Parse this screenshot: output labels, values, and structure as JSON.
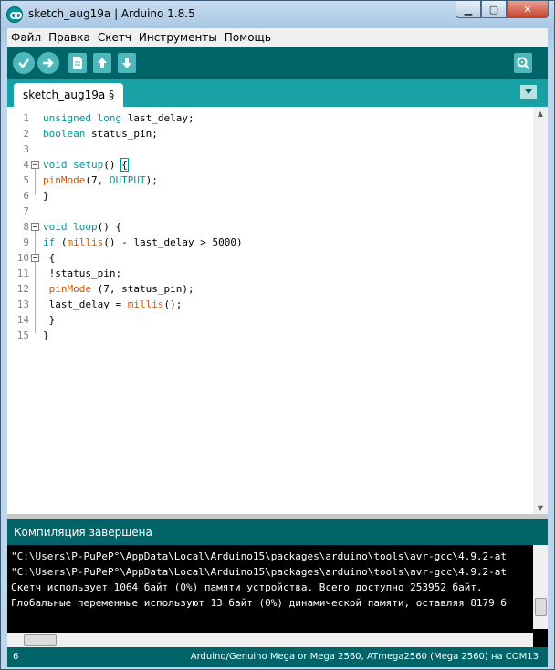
{
  "window": {
    "title": "sketch_aug19a | Arduino 1.8.5"
  },
  "menu": [
    "Файл",
    "Правка",
    "Скетч",
    "Инструменты",
    "Помощь"
  ],
  "toolbar": {
    "buttons": [
      {
        "name": "verify-icon"
      },
      {
        "name": "upload-icon"
      },
      {
        "name": "new-icon"
      },
      {
        "name": "open-icon"
      },
      {
        "name": "save-icon"
      },
      {
        "name": "serial-monitor-icon"
      }
    ]
  },
  "tabs": {
    "active": "sketch_aug19a §"
  },
  "editor": {
    "line_numbers": [
      "1",
      "2",
      "3",
      "4",
      "5",
      "6",
      "7",
      "8",
      "9",
      "10",
      "11",
      "12",
      "13",
      "14",
      "15"
    ],
    "lines": [
      "unsigned long last_delay;",
      "boolean status_pin;",
      "",
      "void setup() {",
      "pinMode(7, OUTPUT);",
      "}",
      "",
      "void loop() {",
      "if (millis() - last_delay > 5000)",
      " {",
      " !status_pin;",
      " pinMode (7, status_pin);",
      " last_delay = millis();",
      " }",
      "}"
    ]
  },
  "status": {
    "message": "Компиляция завершена"
  },
  "console": {
    "lines": [
      "\"C:\\Users\\P-PuPeP°\\AppData\\Local\\Arduino15\\packages\\arduino\\tools\\avr-gcc\\4.9.2-at",
      "\"C:\\Users\\P-PuPeP°\\AppData\\Local\\Arduino15\\packages\\arduino\\tools\\avr-gcc\\4.9.2-at",
      "Скетч использует 1064 байт (0%) памяти устройства. Всего доступно 253952 байт.",
      "Глобальные переменные используют 13 байт (0%) динамической памяти, оставляя 8179 б"
    ]
  },
  "footer": {
    "line": "6",
    "board": "Arduino/Genuino Mega or Mega 2560, ATmega2560 (Mega 2560) на COM13"
  },
  "colors": {
    "teal_dark": "#006468",
    "teal_mid": "#17a1a5",
    "keyword": "#00979c",
    "function": "#d35400"
  }
}
